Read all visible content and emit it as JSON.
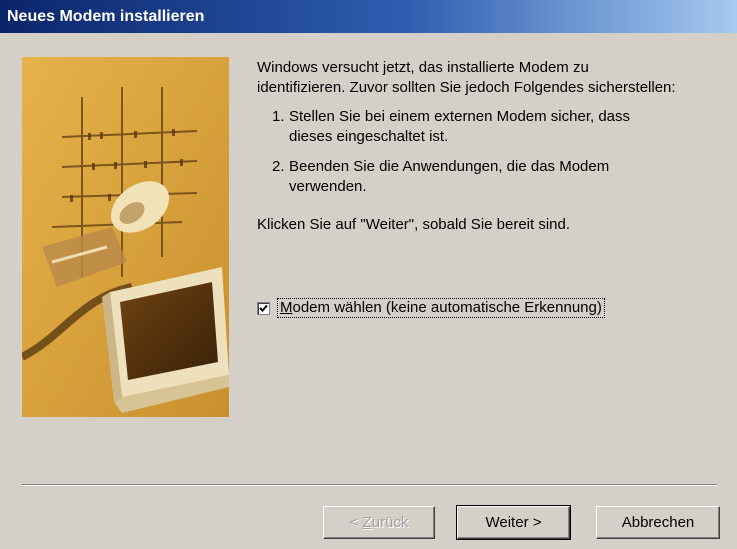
{
  "window": {
    "title": "Neues Modem installieren"
  },
  "content": {
    "intro": "Windows versucht jetzt, das installierte Modem zu identifizieren. Zuvor sollten Sie jedoch Folgendes sicherstellen:",
    "steps": [
      {
        "num": "1.",
        "text": "Stellen Sie bei einem externen Modem sicher, dass dieses eingeschaltet ist."
      },
      {
        "num": "2.",
        "text": "Beenden Sie die Anwendungen, die das Modem verwenden."
      }
    ],
    "ready": "Klicken Sie auf \"Weiter\", sobald Sie bereit sind."
  },
  "checkbox": {
    "checked": true,
    "mnemonic": "M",
    "label_rest": "odem wählen (keine automatische Erkennung)"
  },
  "buttons": {
    "back_prefix": "< ",
    "back_mnemonic": "Z",
    "back_rest": "urück",
    "next_label": "Weiter >",
    "cancel_label": "Abbrechen"
  },
  "colors": {
    "title_gradient_start": "#0a246a",
    "title_gradient_end": "#a6caf0",
    "dialog_bg": "#d4d0c8",
    "illustration_bg": "#d9a640"
  },
  "icons": {
    "illustration": "modem-computer-illustration",
    "check": "checkmark-icon"
  }
}
